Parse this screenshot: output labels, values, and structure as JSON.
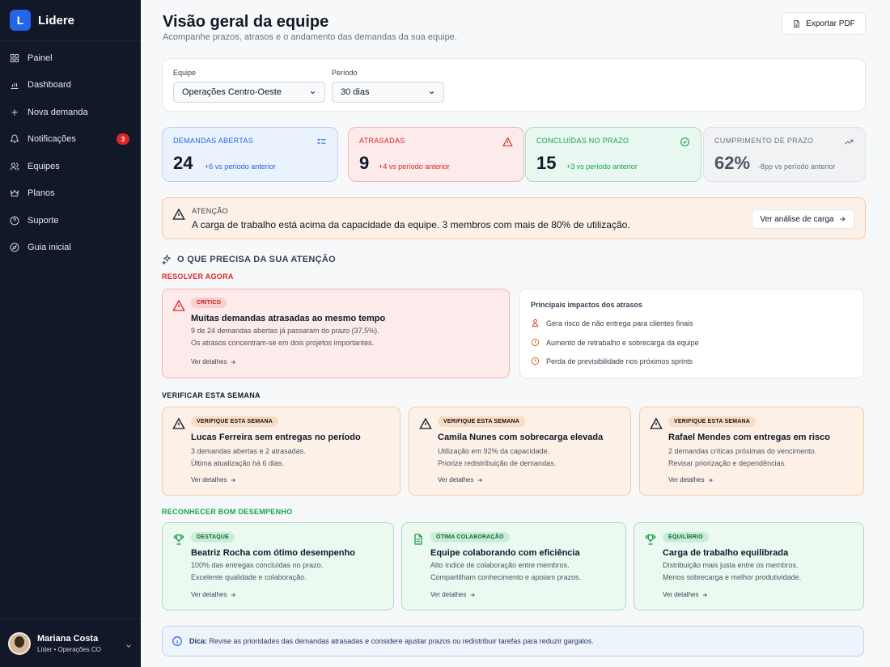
{
  "app": {
    "logo_letter": "L",
    "name": "Lidere"
  },
  "sidebar": {
    "items": [
      {
        "label": "Painel",
        "icon": "grid-icon"
      },
      {
        "label": "Dashboard",
        "icon": "bar-chart-icon"
      },
      {
        "label": "Nova demanda",
        "icon": "plus-icon"
      },
      {
        "label": "Notificações",
        "icon": "bell-icon",
        "badge": "3"
      },
      {
        "label": "Equipes",
        "icon": "users-icon"
      },
      {
        "label": "Planos",
        "icon": "crown-icon"
      },
      {
        "label": "Suporte",
        "icon": "help-icon"
      },
      {
        "label": "Guia inicial",
        "icon": "compass-icon"
      }
    ],
    "user": {
      "name": "Mariana Costa",
      "role": "Líder • Operações CO"
    }
  },
  "header": {
    "title": "Visão geral da equipe",
    "subtitle": "Acompanhe prazos, atrasos e o andamento das demandas da sua equipe.",
    "export_label": "Exportar PDF"
  },
  "filters": {
    "team_label": "Equipe",
    "team_value": "Operações Centro-Oeste",
    "period_label": "Período",
    "period_value": "30 dias"
  },
  "kpis": [
    {
      "label": "DEMANDAS ABERTAS",
      "value": "24",
      "delta": "+6 vs período anterior",
      "color": "#2563eb"
    },
    {
      "label": "ATRASADAS",
      "value": "9",
      "delta": "+4 vs período anterior",
      "color": "#dc2626"
    },
    {
      "label": "CONCLUÍDAS NO PRAZO",
      "value": "15",
      "delta": "+3 vs período anterior",
      "color": "#16a34a"
    },
    {
      "label": "CUMPRIMENTO DE PRAZO",
      "value": "62%",
      "delta": "-8pp vs período anterior",
      "color": "#6b7280"
    }
  ],
  "alert": {
    "title": "ATENÇÃO",
    "text": "A carga de trabalho está acima da capacidade da equipe. 3 membros com mais de 80% de utilização.",
    "button": "Ver análise de carga"
  },
  "section_title": "O QUE PRECISA DA SUA ATENÇÃO",
  "resolve": {
    "label": "RESOLVER AGORA",
    "card": {
      "badge": "CRÍTICO",
      "title": "Muitas demandas atrasadas ao mesmo tempo",
      "line1": "9 de 24 demandas abertas já passaram do prazo (37,5%).",
      "line2": "Os atrasos concentram-se em dois projetos importantes.",
      "link": "Ver detalhes"
    },
    "impacts": {
      "title": "Principais impactos dos atrasos",
      "items": [
        "Gera risco de não entrega para clientes finais",
        "Aumento de retrabalho e sobrecarga da equipe",
        "Perda de previsibilidade nos próximos sprints"
      ]
    }
  },
  "verify": {
    "label": "VERIFICAR ESTA SEMANA",
    "cards": [
      {
        "badge": "VERIFIQUE ESTA SEMANA",
        "title": "Lucas Ferreira sem entregas no período",
        "line1": "3 demandas abertas e 2 atrasadas.",
        "line2": "Última atualização há 6 dias.",
        "link": "Ver detalhes"
      },
      {
        "badge": "VERIFIQUE ESTA SEMANA",
        "title": "Camila Nunes com sobrecarga elevada",
        "line1": "Utilização em 92% da capacidade.",
        "line2": "Priorize redistribuição de demandas.",
        "link": "Ver detalhes"
      },
      {
        "badge": "VERIFIQUE ESTA SEMANA",
        "title": "Rafael Mendes com entregas em risco",
        "line1": "2 demandas críticas próximas do vencimento.",
        "line2": "Revisar priorização e dependências.",
        "link": "Ver detalhes"
      }
    ]
  },
  "recognize": {
    "label": "RECONHECER BOM DESEMPENHO",
    "cards": [
      {
        "badge": "DESTAQUE",
        "title": "Beatriz Rocha com ótimo desempenho",
        "line1": "100% das entregas concluídas no prazo.",
        "line2": "Excelente qualidade e colaboração.",
        "link": "Ver detalhes",
        "icon": "trophy-icon"
      },
      {
        "badge": "ÓTIMA COLABORAÇÃO",
        "title": "Equipe colaborando com eficiência",
        "line1": "Alto índice de colaboração entre membros.",
        "line2": "Compartilham conhecimento e apoiam prazos.",
        "link": "Ver detalhes",
        "icon": "document-icon"
      },
      {
        "badge": "EQUILÍBRIO",
        "title": "Carga de trabalho equilibrada",
        "line1": "Distribuição mais justa entre os membros.",
        "line2": "Menos sobrecarga e melhor produtividade.",
        "link": "Ver detalhes",
        "icon": "trophy-icon"
      }
    ]
  },
  "tip": {
    "prefix": "Dica:",
    "text": "Revise as prioridades das demandas atrasadas e considere ajustar prazos ou redistribuir tarefas para reduzir gargalos."
  }
}
